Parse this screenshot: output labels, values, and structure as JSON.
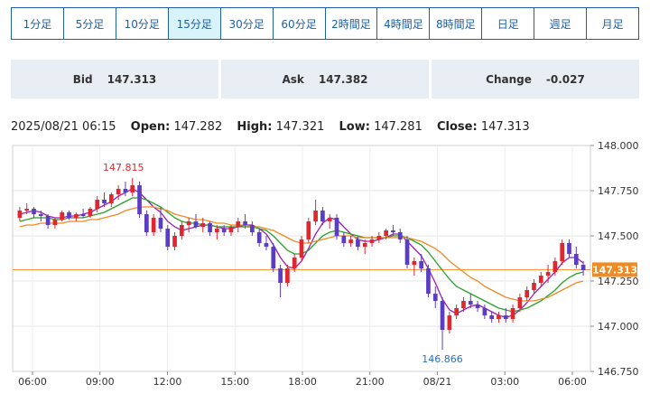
{
  "tabs": [
    {
      "label": "1分足",
      "active": false
    },
    {
      "label": "5分足",
      "active": false
    },
    {
      "label": "10分足",
      "active": false
    },
    {
      "label": "15分足",
      "active": true
    },
    {
      "label": "30分足",
      "active": false
    },
    {
      "label": "60分足",
      "active": false
    },
    {
      "label": "2時間足",
      "active": false
    },
    {
      "label": "4時間足",
      "active": false
    },
    {
      "label": "8時間足",
      "active": false
    },
    {
      "label": "日足",
      "active": false
    },
    {
      "label": "週足",
      "active": false
    },
    {
      "label": "月足",
      "active": false
    }
  ],
  "quotes": {
    "bid_label": "Bid",
    "bid_value": "147.313",
    "ask_label": "Ask",
    "ask_value": "147.382",
    "change_label": "Change",
    "change_value": "-0.027"
  },
  "ohlc": {
    "datetime": "2025/08/21 06:15",
    "open_label": "Open:",
    "open": "147.282",
    "high_label": "High:",
    "high": "147.321",
    "low_label": "Low:",
    "low": "147.281",
    "close_label": "Close:",
    "close": "147.313"
  },
  "colors": {
    "up": "#e0262f",
    "down": "#5b3cc4",
    "ma_short": "#9b1fb5",
    "ma_mid": "#2aa12a",
    "ma_long": "#f08a24",
    "price_line": "#f08a24",
    "price_tag": "#f08a24",
    "annotation_high": "#e0262f",
    "annotation_low": "#2e6fb5"
  },
  "chart_data": {
    "type": "candlestick",
    "ylim": [
      146.75,
      148.0
    ],
    "y_ticks": [
      "148.000",
      "147.750",
      "147.500",
      "147.250",
      "147.000",
      "146.750"
    ],
    "x_ticks": [
      "06:00",
      "09:00",
      "12:00",
      "15:00",
      "18:00",
      "21:00",
      "08/21",
      "03:00",
      "06:00"
    ],
    "grid": true,
    "current_price": "147.313",
    "annotations": {
      "high": "147.815",
      "low": "146.866"
    },
    "candles": [
      [
        147.6,
        147.66,
        147.58,
        147.64
      ],
      [
        147.64,
        147.68,
        147.62,
        147.65
      ],
      [
        147.65,
        147.66,
        147.6,
        147.62
      ],
      [
        147.62,
        147.64,
        147.58,
        147.61
      ],
      [
        147.61,
        147.62,
        147.54,
        147.56
      ],
      [
        147.56,
        147.6,
        147.54,
        147.59
      ],
      [
        147.59,
        147.64,
        147.58,
        147.63
      ],
      [
        147.63,
        147.64,
        147.59,
        147.6
      ],
      [
        147.6,
        147.63,
        147.58,
        147.62
      ],
      [
        147.62,
        147.65,
        147.6,
        147.61
      ],
      [
        147.61,
        147.66,
        147.6,
        147.65
      ],
      [
        147.65,
        147.72,
        147.63,
        147.7
      ],
      [
        147.7,
        147.74,
        147.66,
        147.68
      ],
      [
        147.68,
        147.74,
        147.66,
        147.73
      ],
      [
        147.73,
        147.78,
        147.7,
        147.76
      ],
      [
        147.76,
        147.8,
        147.72,
        147.74
      ],
      [
        147.74,
        147.82,
        147.72,
        147.78
      ],
      [
        147.78,
        147.8,
        147.6,
        147.62
      ],
      [
        147.62,
        147.64,
        147.5,
        147.52
      ],
      [
        147.52,
        147.62,
        147.5,
        147.6
      ],
      [
        147.6,
        147.66,
        147.52,
        147.54
      ],
      [
        147.54,
        147.56,
        147.42,
        147.44
      ],
      [
        147.44,
        147.52,
        147.42,
        147.5
      ],
      [
        147.5,
        147.58,
        147.48,
        147.56
      ],
      [
        147.56,
        147.6,
        147.52,
        147.58
      ],
      [
        147.58,
        147.62,
        147.54,
        147.55
      ],
      [
        147.55,
        147.6,
        147.52,
        147.57
      ],
      [
        147.57,
        147.58,
        147.5,
        147.52
      ],
      [
        147.52,
        147.56,
        147.48,
        147.54
      ],
      [
        147.54,
        147.56,
        147.5,
        147.52
      ],
      [
        147.52,
        147.56,
        147.5,
        147.55
      ],
      [
        147.55,
        147.6,
        147.52,
        147.58
      ],
      [
        147.58,
        147.62,
        147.54,
        147.56
      ],
      [
        147.56,
        147.58,
        147.5,
        147.52
      ],
      [
        147.52,
        147.54,
        147.44,
        147.46
      ],
      [
        147.46,
        147.5,
        147.42,
        147.44
      ],
      [
        147.44,
        147.46,
        147.3,
        147.32
      ],
      [
        147.32,
        147.34,
        147.16,
        147.24
      ],
      [
        147.24,
        147.34,
        147.22,
        147.32
      ],
      [
        147.32,
        147.4,
        147.3,
        147.38
      ],
      [
        147.38,
        147.5,
        147.36,
        147.48
      ],
      [
        147.48,
        147.6,
        147.46,
        147.58
      ],
      [
        147.58,
        147.7,
        147.56,
        147.64
      ],
      [
        147.64,
        147.66,
        147.56,
        147.58
      ],
      [
        147.58,
        147.62,
        147.54,
        147.6
      ],
      [
        147.6,
        147.62,
        147.48,
        147.5
      ],
      [
        147.5,
        147.52,
        147.44,
        147.46
      ],
      [
        147.46,
        147.5,
        147.44,
        147.48
      ],
      [
        147.48,
        147.5,
        147.42,
        147.44
      ],
      [
        147.44,
        147.48,
        147.4,
        147.46
      ],
      [
        147.46,
        147.5,
        147.44,
        147.48
      ],
      [
        147.48,
        147.52,
        147.46,
        147.5
      ],
      [
        147.5,
        147.54,
        147.48,
        147.53
      ],
      [
        147.53,
        147.56,
        147.5,
        147.52
      ],
      [
        147.52,
        147.54,
        147.46,
        147.48
      ],
      [
        147.48,
        147.5,
        147.32,
        147.34
      ],
      [
        147.34,
        147.38,
        147.28,
        147.36
      ],
      [
        147.36,
        147.4,
        147.3,
        147.32
      ],
      [
        147.32,
        147.34,
        147.16,
        147.18
      ],
      [
        147.18,
        147.22,
        147.1,
        147.14
      ],
      [
        147.14,
        147.16,
        146.87,
        146.98
      ],
      [
        146.98,
        147.08,
        146.96,
        147.06
      ],
      [
        147.06,
        147.12,
        147.04,
        147.1
      ],
      [
        147.1,
        147.16,
        147.08,
        147.14
      ],
      [
        147.14,
        147.18,
        147.1,
        147.12
      ],
      [
        147.12,
        147.14,
        147.08,
        147.1
      ],
      [
        147.1,
        147.12,
        147.04,
        147.06
      ],
      [
        147.06,
        147.08,
        147.02,
        147.04
      ],
      [
        147.04,
        147.08,
        147.02,
        147.06
      ],
      [
        147.06,
        147.1,
        147.02,
        147.04
      ],
      [
        147.04,
        147.12,
        147.02,
        147.1
      ],
      [
        147.1,
        147.18,
        147.08,
        147.16
      ],
      [
        147.16,
        147.22,
        147.14,
        147.2
      ],
      [
        147.2,
        147.26,
        147.18,
        147.24
      ],
      [
        147.24,
        147.3,
        147.22,
        147.28
      ],
      [
        147.28,
        147.34,
        147.24,
        147.3
      ],
      [
        147.3,
        147.38,
        147.28,
        147.36
      ],
      [
        147.36,
        147.48,
        147.34,
        147.46
      ],
      [
        147.46,
        147.48,
        147.38,
        147.4
      ],
      [
        147.4,
        147.44,
        147.32,
        147.34
      ],
      [
        147.34,
        147.36,
        147.28,
        147.31
      ]
    ],
    "series": [
      {
        "name": "",
        "color_key": "ma_short",
        "values": [
          147.62,
          147.63,
          147.64,
          147.63,
          147.61,
          147.6,
          147.6,
          147.61,
          147.61,
          147.62,
          147.63,
          147.65,
          147.67,
          147.69,
          147.72,
          147.74,
          147.76,
          147.74,
          147.7,
          147.66,
          147.63,
          147.58,
          147.55,
          147.53,
          147.54,
          147.55,
          147.56,
          147.56,
          147.55,
          147.54,
          147.54,
          147.55,
          147.56,
          147.56,
          147.54,
          147.51,
          147.45,
          147.38,
          147.33,
          147.32,
          147.36,
          147.43,
          147.51,
          147.57,
          147.6,
          147.59,
          147.55,
          147.51,
          147.48,
          147.47,
          147.47,
          147.48,
          147.49,
          147.51,
          147.51,
          147.47,
          147.43,
          147.39,
          147.32,
          147.24,
          147.15,
          147.09,
          147.07,
          147.09,
          147.11,
          147.12,
          147.1,
          147.08,
          147.06,
          147.05,
          147.06,
          147.09,
          147.13,
          147.18,
          147.22,
          147.26,
          147.3,
          147.35,
          147.38,
          147.38,
          147.35
        ]
      },
      {
        "name": "",
        "color_key": "ma_mid",
        "values": [
          147.58,
          147.59,
          147.6,
          147.6,
          147.6,
          147.59,
          147.59,
          147.6,
          147.6,
          147.6,
          147.61,
          147.62,
          147.63,
          147.65,
          147.67,
          147.69,
          147.71,
          147.71,
          147.7,
          147.68,
          147.66,
          147.63,
          147.6,
          147.58,
          147.57,
          147.57,
          147.56,
          147.56,
          147.55,
          147.55,
          147.55,
          147.55,
          147.55,
          147.55,
          147.54,
          147.53,
          147.5,
          147.46,
          147.42,
          147.4,
          147.4,
          147.42,
          147.46,
          147.5,
          147.52,
          147.53,
          147.52,
          147.51,
          147.5,
          147.49,
          147.49,
          147.49,
          147.49,
          147.5,
          147.5,
          147.49,
          147.47,
          147.45,
          147.41,
          147.36,
          147.31,
          147.26,
          147.22,
          147.2,
          147.18,
          147.16,
          147.14,
          147.12,
          147.1,
          147.09,
          147.08,
          147.09,
          147.1,
          147.12,
          147.14,
          147.17,
          147.2,
          147.24,
          147.27,
          147.29,
          147.3
        ]
      },
      {
        "name": "",
        "color_key": "ma_long",
        "values": [
          147.55,
          147.56,
          147.56,
          147.57,
          147.57,
          147.57,
          147.57,
          147.58,
          147.58,
          147.58,
          147.59,
          147.59,
          147.6,
          147.61,
          147.62,
          147.64,
          147.65,
          147.66,
          147.66,
          147.66,
          147.65,
          147.64,
          147.62,
          147.61,
          147.6,
          147.59,
          147.59,
          147.58,
          147.57,
          147.57,
          147.56,
          147.56,
          147.56,
          147.55,
          147.55,
          147.54,
          147.53,
          147.51,
          147.49,
          147.47,
          147.46,
          147.46,
          147.47,
          147.48,
          147.49,
          147.5,
          147.5,
          147.5,
          147.49,
          147.49,
          147.49,
          147.49,
          147.49,
          147.49,
          147.49,
          147.49,
          147.48,
          147.47,
          147.45,
          147.43,
          147.4,
          147.36,
          147.33,
          147.3,
          147.27,
          147.25,
          147.22,
          147.2,
          147.18,
          147.16,
          147.15,
          147.14,
          147.14,
          147.14,
          147.15,
          147.16,
          147.18,
          147.2,
          147.22,
          147.24,
          147.25
        ]
      }
    ]
  }
}
